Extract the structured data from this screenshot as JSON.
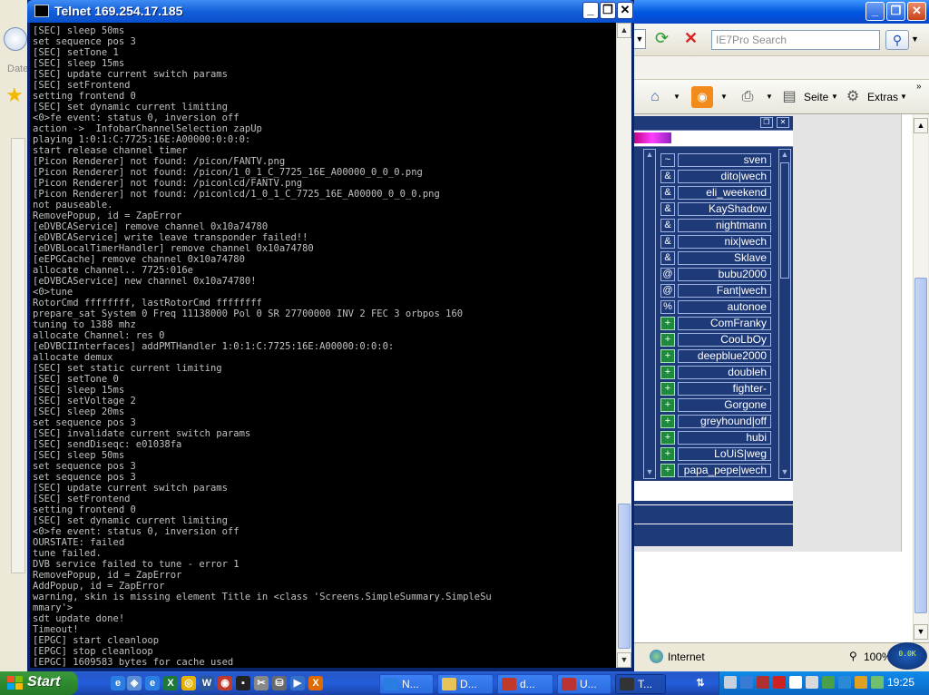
{
  "telnet": {
    "title": "Telnet 169.254.17.185",
    "lines": [
      "[SEC] sleep 50ms",
      "set sequence pos 3",
      "[SEC] setTone 1",
      "[SEC] sleep 15ms",
      "[SEC] update current switch params",
      "[SEC] setFrontend",
      "setting frontend 0",
      "[SEC] set dynamic current limiting",
      "<0>fe event: status 0, inversion off",
      "action ->  InfobarChannelSelection zapUp",
      "playing 1:0:1:C:7725:16E:A00000:0:0:0:",
      "start release channel timer",
      "[Picon Renderer] not found: /picon/FANTV.png",
      "[Picon Renderer] not found: /picon/1_0_1_C_7725_16E_A00000_0_0_0.png",
      "[Picon Renderer] not found: /piconlcd/FANTV.png",
      "[Picon Renderer] not found: /piconlcd/1_0_1_C_7725_16E_A00000_0_0_0.png",
      "not pauseable.",
      "RemovePopup, id = ZapError",
      "[eDVBCAService] remove channel 0x10a74780",
      "[eDVBCAService] write leave transponder failed!!",
      "[eDVBLocalTimerHandler] remove channel 0x10a74780",
      "[eEPGCache] remove channel 0x10a74780",
      "allocate channel.. 7725:016e",
      "[eDVBCAService] new channel 0x10a74780!",
      "<0>tune",
      "RotorCmd ffffffff, lastRotorCmd ffffffff",
      "prepare_sat System 0 Freq 11138000 Pol 0 SR 27700000 INV 2 FEC 3 orbpos 160",
      "tuning to 1388 mhz",
      "allocate Channel: res 0",
      "[eDVBCIInterfaces] addPMTHandler 1:0:1:C:7725:16E:A00000:0:0:0:",
      "allocate demux",
      "[SEC] set static current limiting",
      "[SEC] setTone 0",
      "[SEC] sleep 15ms",
      "[SEC] setVoltage 2",
      "[SEC] sleep 20ms",
      "set sequence pos 3",
      "[SEC] invalidate current switch params",
      "[SEC] sendDiseqc: e01038fa",
      "[SEC] sleep 50ms",
      "set sequence pos 3",
      "set sequence pos 3",
      "[SEC] update current switch params",
      "[SEC] setFrontend",
      "setting frontend 0",
      "[SEC] set dynamic current limiting",
      "<0>fe event: status 0, inversion off",
      "OURSTATE: failed",
      "tune failed.",
      "DVB service failed to tune - error 1",
      "RemovePopup, id = ZapError",
      "AddPopup, id = ZapError",
      "warning, skin is missing element Title in <class 'Screens.SimpleSummary.SimpleSu",
      "mmary'>",
      "sdt update done!",
      "Timeout!",
      "[EPGC] start cleanloop",
      "[EPGC] stop cleanloop",
      "[EPGC] 1609583 bytes for cache used"
    ]
  },
  "browser": {
    "search_placeholder": "IE7Pro Search",
    "home_label": "",
    "page_label": "Seite",
    "extras_label": "Extras",
    "status_zone": "Internet",
    "zoom": "100%",
    "left_strip_label": "Date"
  },
  "chat": {
    "users": [
      {
        "badge": "~",
        "name": "sven"
      },
      {
        "badge": "&",
        "name": "dito|wech"
      },
      {
        "badge": "&",
        "name": "eli_weekend"
      },
      {
        "badge": "&",
        "name": "KayShadow"
      },
      {
        "badge": "&",
        "name": "nightmann"
      },
      {
        "badge": "&",
        "name": "nix|wech"
      },
      {
        "badge": "&",
        "name": "Sklave"
      },
      {
        "badge": "@",
        "name": "bubu2000"
      },
      {
        "badge": "@",
        "name": "Fant|wech"
      },
      {
        "badge": "%",
        "name": "autonoe"
      },
      {
        "badge": "+",
        "name": "ComFranky"
      },
      {
        "badge": "+",
        "name": "CooLbOy"
      },
      {
        "badge": "+",
        "name": "deepblue2000"
      },
      {
        "badge": "+",
        "name": "doubleh"
      },
      {
        "badge": "+",
        "name": "fighter-"
      },
      {
        "badge": "+",
        "name": "Gorgone"
      },
      {
        "badge": "+",
        "name": "greyhound|off"
      },
      {
        "badge": "+",
        "name": "hubi"
      },
      {
        "badge": "+",
        "name": "LoUiS|weg"
      },
      {
        "badge": "+",
        "name": "papa_pepe|wech"
      }
    ]
  },
  "taskbar": {
    "start_label": "Start",
    "buttons": [
      {
        "label": "N..."
      },
      {
        "label": "D..."
      },
      {
        "label": "d..."
      },
      {
        "label": "U..."
      },
      {
        "label": "T..."
      }
    ],
    "clock": "19:25"
  },
  "colors": {
    "terminal_bg": "#000000",
    "terminal_fg": "#c0c0c0",
    "xp_title": "#0054e3",
    "taskbar": "#245edb",
    "start_green": "#2f8a2f"
  }
}
